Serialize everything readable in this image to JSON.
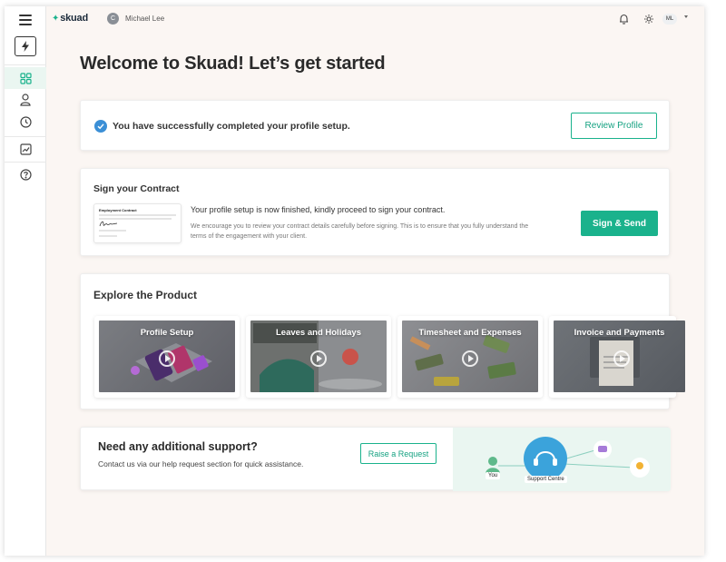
{
  "app": {
    "logo_text": "skuad",
    "user_initial": "C",
    "user_name": "Michael Lee",
    "avatar_initials": "ML"
  },
  "sidebar": {
    "items": [
      {
        "name": "dashboard",
        "icon": "grid-icon",
        "active": true
      },
      {
        "name": "profile",
        "icon": "user-icon"
      },
      {
        "name": "history",
        "icon": "clock-icon"
      },
      {
        "name": "analytics",
        "icon": "chart-icon"
      },
      {
        "name": "help",
        "icon": "help-icon"
      }
    ]
  },
  "page": {
    "title": "Welcome to Skuad! Let’s get started"
  },
  "profile_card": {
    "message": "You have successfully completed your profile setup.",
    "button": "Review Profile"
  },
  "contract_card": {
    "heading": "Sign your Contract",
    "doc_title": "Employment Contract",
    "main_text": "Your profile setup is now finished, kindly proceed to sign your contract.",
    "sub_text": "We encourage you to review your contract details carefully before signing. This is to ensure that you fully understand the terms of the engagement with your client.",
    "button": "Sign & Send"
  },
  "explore": {
    "heading": "Explore the Product",
    "tiles": [
      {
        "label": "Profile Setup"
      },
      {
        "label": "Leaves and Holidays"
      },
      {
        "label": "Timesheet and Expenses"
      },
      {
        "label": "Invoice and Payments"
      }
    ]
  },
  "support": {
    "title": "Need any additional support?",
    "subtitle": "Contact us via our help request section for quick assistance.",
    "button": "Raise a Request",
    "you_label": "You",
    "centre_label": "Support Centre"
  },
  "colors": {
    "accent": "#1ab28c",
    "check": "#3b8fd6",
    "background": "#fbf6f3"
  }
}
